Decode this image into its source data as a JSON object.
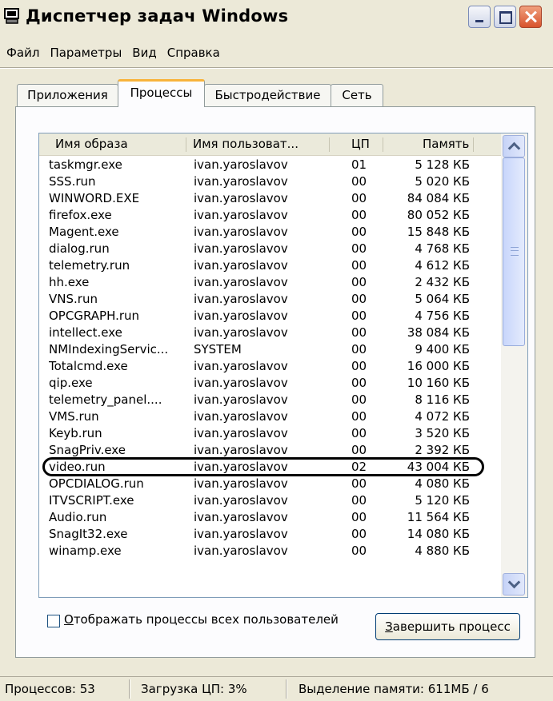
{
  "window": {
    "title": "Диспетчер задач Windows"
  },
  "menu": [
    "Файл",
    "Параметры",
    "Вид",
    "Справка"
  ],
  "tabs": [
    {
      "label": "Приложения",
      "active": false
    },
    {
      "label": "Процессы",
      "active": true
    },
    {
      "label": "Быстродействие",
      "active": false
    },
    {
      "label": "Сеть",
      "active": false
    }
  ],
  "table": {
    "headers": [
      "Имя образа",
      "Имя пользоват...",
      "ЦП",
      "Память"
    ],
    "rows": [
      [
        "taskmgr.exe",
        "ivan.yaroslavov",
        "01",
        "5 128 КБ"
      ],
      [
        "SSS.run",
        "ivan.yaroslavov",
        "00",
        "5 020 КБ"
      ],
      [
        "WINWORD.EXE",
        "ivan.yaroslavov",
        "00",
        "84 084 КБ"
      ],
      [
        "firefox.exe",
        "ivan.yaroslavov",
        "00",
        "80 052 КБ"
      ],
      [
        "Magent.exe",
        "ivan.yaroslavov",
        "00",
        "15 848 КБ"
      ],
      [
        "dialog.run",
        "ivan.yaroslavov",
        "00",
        "4 768 КБ"
      ],
      [
        "telemetry.run",
        "ivan.yaroslavov",
        "00",
        "4 612 КБ"
      ],
      [
        "hh.exe",
        "ivan.yaroslavov",
        "00",
        "2 432 КБ"
      ],
      [
        "VNS.run",
        "ivan.yaroslavov",
        "00",
        "5 064 КБ"
      ],
      [
        "OPCGRAPH.run",
        "ivan.yaroslavov",
        "00",
        "4 756 КБ"
      ],
      [
        "intellect.exe",
        "ivan.yaroslavov",
        "00",
        "38 084 КБ"
      ],
      [
        "NMIndexingServic...",
        "SYSTEM",
        "00",
        "9 400 КБ"
      ],
      [
        "Totalcmd.exe",
        "ivan.yaroslavov",
        "00",
        "16 000 КБ"
      ],
      [
        "qip.exe",
        "ivan.yaroslavov",
        "00",
        "10 160 КБ"
      ],
      [
        "telemetry_panel....",
        "ivan.yaroslavov",
        "00",
        "8 116 КБ"
      ],
      [
        "VMS.run",
        "ivan.yaroslavov",
        "00",
        "4 072 КБ"
      ],
      [
        "Keyb.run",
        "ivan.yaroslavov",
        "00",
        "3 520 КБ"
      ],
      [
        "SnagPriv.exe",
        "ivan.yaroslavov",
        "00",
        "2 392 КБ"
      ],
      [
        "video.run",
        "ivan.yaroslavov",
        "02",
        "43 004 КБ"
      ],
      [
        "OPCDIALOG.run",
        "ivan.yaroslavov",
        "00",
        "4 080 КБ"
      ],
      [
        "ITVSCRIPT.exe",
        "ivan.yaroslavov",
        "00",
        "5 120 КБ"
      ],
      [
        "Audio.run",
        "ivan.yaroslavov",
        "00",
        "11 564 КБ"
      ],
      [
        "SnagIt32.exe",
        "ivan.yaroslavov",
        "00",
        "14 080 КБ"
      ],
      [
        "winamp.exe",
        "ivan.yaroslavov",
        "00",
        "4 880 КБ"
      ]
    ],
    "highlighted_row": 18
  },
  "show_all_users": {
    "label": "Отображать процессы всех пользователей",
    "underlined_char": "О",
    "checked": false
  },
  "end_process_button": {
    "label": "Завершить процесс",
    "underlined_char": "З"
  },
  "status": {
    "processes": "Процессов: 53",
    "cpu": "Загрузка ЦП: 3%",
    "memory": "Выделение памяти: 611МБ / 6"
  },
  "icons": {
    "app": "task-manager-icon",
    "minimize": "minimize-icon",
    "maximize": "maximize-icon",
    "close": "close-icon",
    "scroll_up": "chevron-up-icon",
    "scroll_down": "chevron-down-icon"
  }
}
